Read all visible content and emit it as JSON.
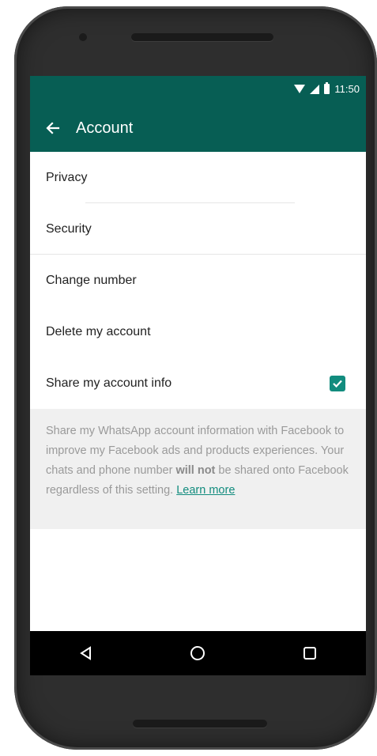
{
  "status_bar": {
    "time": "11:50"
  },
  "toolbar": {
    "back_icon": "arrow-back-icon",
    "title": "Account"
  },
  "menu": {
    "items": [
      {
        "label": "Privacy"
      },
      {
        "label": "Security"
      },
      {
        "label": "Change number"
      },
      {
        "label": "Delete my account"
      }
    ],
    "share": {
      "label": "Share my account info",
      "checked": true
    }
  },
  "info": {
    "text_before": "Share my WhatsApp account information with Facebook to improve my Facebook ads and products experiences. Your chats and phone number ",
    "bold_text": "will not",
    "text_after": " be shared onto Facebook regardless of this setting. ",
    "link_text": "Learn more"
  },
  "nav_bar": {
    "back_icon": "triangle-back-icon",
    "home_icon": "circle-home-icon",
    "recents_icon": "square-recents-icon"
  },
  "colors": {
    "header": "#075e54",
    "accent": "#128c7e"
  }
}
